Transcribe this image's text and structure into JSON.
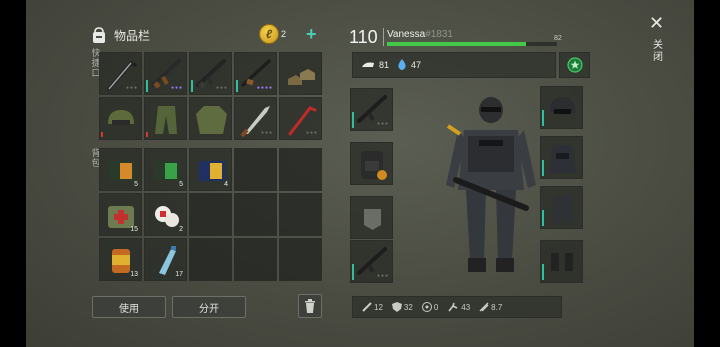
{
  "inventory": {
    "title": "物品栏",
    "coins": {
      "count": "2",
      "add_label": "+"
    },
    "quick_slot_label": "快捷口",
    "backpack_label": "背包",
    "quick_slots": [
      {
        "icon": "crowbar-icon",
        "qty": ""
      },
      {
        "icon": "ak47-rifle-icon",
        "qty": ""
      },
      {
        "icon": "ak47-rifle-icon",
        "qty": ""
      },
      {
        "icon": "shotgun-icon",
        "qty": ""
      },
      {
        "icon": "boots-icon",
        "qty": ""
      },
      {
        "icon": "camo-helmet-icon",
        "qty": ""
      },
      {
        "icon": "camo-pants-icon",
        "qty": ""
      },
      {
        "icon": "camo-jacket-icon",
        "qty": ""
      },
      {
        "icon": "machete-icon",
        "qty": ""
      },
      {
        "icon": "crowbar-icon",
        "qty": ""
      }
    ],
    "backpack": [
      {
        "icon": "book-orange-icon",
        "qty": "5"
      },
      {
        "icon": "book-green-icon",
        "qty": "5"
      },
      {
        "icon": "book-blue-icon",
        "qty": "4"
      },
      {
        "icon": "empty",
        "qty": ""
      },
      {
        "icon": "empty",
        "qty": ""
      },
      {
        "icon": "first-aid-bag-icon",
        "qty": "15"
      },
      {
        "icon": "bandage-icon",
        "qty": "2"
      },
      {
        "icon": "empty",
        "qty": ""
      },
      {
        "icon": "empty",
        "qty": ""
      },
      {
        "icon": "empty",
        "qty": ""
      },
      {
        "icon": "canned-food-icon",
        "qty": "13"
      },
      {
        "icon": "water-bottle-icon",
        "qty": "17"
      },
      {
        "icon": "empty",
        "qty": ""
      },
      {
        "icon": "empty",
        "qty": ""
      },
      {
        "icon": "empty",
        "qty": ""
      }
    ],
    "use_button": "使用",
    "split_button": "分开"
  },
  "character": {
    "level": "110",
    "name": "Vanessa",
    "id": "#1831",
    "xp_value": "82",
    "xp_fraction": 0.82,
    "hunger": "81",
    "thirst": "47",
    "equipment_left": [
      {
        "icon": "m4-rifle-icon"
      },
      {
        "icon": "tactical-backpack-icon"
      },
      {
        "icon": "pocket-patch-icon"
      },
      {
        "icon": "m4-rifle-icon"
      }
    ],
    "equipment_right": [
      {
        "icon": "tactical-helmet-icon"
      },
      {
        "icon": "tactical-vest-icon"
      },
      {
        "icon": "tactical-pants-icon"
      },
      {
        "icon": "tactical-boots-icon"
      }
    ],
    "combat_stats": [
      {
        "icon": "attack-icon",
        "value": "12"
      },
      {
        "icon": "armor-icon",
        "value": "32"
      },
      {
        "icon": "radiation-icon",
        "value": "0"
      },
      {
        "icon": "speed-icon",
        "value": "43"
      },
      {
        "icon": "weight-icon",
        "value": "8.7"
      }
    ]
  },
  "close": {
    "label": "关闭"
  },
  "colors": {
    "accent": "#2fbfa0",
    "xp_bar": "#43c948",
    "coin": "#e0b030",
    "durability_low": "#d33c2c"
  }
}
